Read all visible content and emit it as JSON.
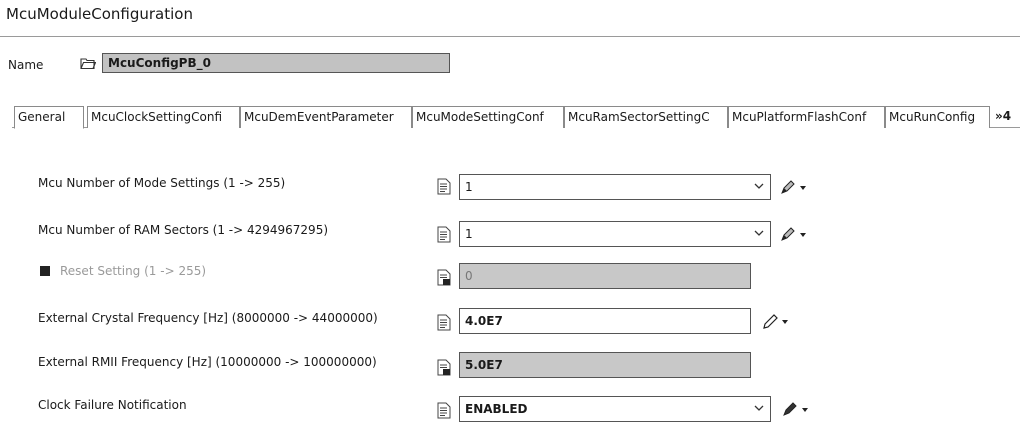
{
  "header": {
    "title": "McuModuleConfiguration"
  },
  "name_row": {
    "label": "Name",
    "value": "McuConfigPB_0"
  },
  "tabs": [
    {
      "label": "General",
      "active": true
    },
    {
      "label": "McuClockSettingConfi"
    },
    {
      "label": "McuDemEventParameter"
    },
    {
      "label": "McuModeSettingConf"
    },
    {
      "label": "McuRamSectorSettingC"
    },
    {
      "label": "McuPlatformFlashConf"
    },
    {
      "label": "McuRunConfig"
    }
  ],
  "tabs_overflow": "»4",
  "params": [
    {
      "label": "Mcu Number of Mode Settings (1 -> 255)",
      "value": "1",
      "kind": "dropdown"
    },
    {
      "label": "Mcu Number of RAM Sectors (1 -> 4294967295)",
      "value": "1",
      "kind": "dropdown"
    },
    {
      "label": "Reset Setting (1 -> 255)",
      "value": "0",
      "kind": "disabled"
    },
    {
      "label": "External Crystal Frequency [Hz] (8000000 -> 44000000)",
      "value": "4.0E7",
      "kind": "text"
    },
    {
      "label": "External RMII Frequency [Hz] (10000000 -> 100000000)",
      "value": "5.0E7",
      "kind": "readonly"
    },
    {
      "label": "Clock Failure Notification",
      "value": "ENABLED",
      "kind": "dropdown"
    }
  ],
  "icons": {
    "folder": "folder-open-icon",
    "doc": "parameter-doc-icon",
    "pencil": "pencil-edit-icon",
    "chevron": "chevron-down-icon",
    "caret": "caret-down-icon"
  }
}
